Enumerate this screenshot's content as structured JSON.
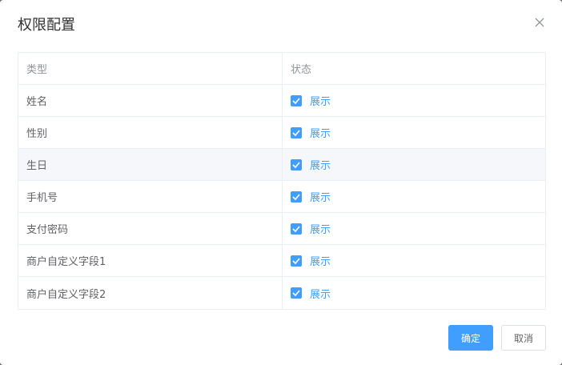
{
  "dialog": {
    "title": "权限配置",
    "close_icon": "close-icon"
  },
  "table": {
    "headers": [
      "类型",
      "状态"
    ],
    "rows": [
      {
        "type": "姓名",
        "checked": true,
        "status_label": "展示"
      },
      {
        "type": "性别",
        "checked": true,
        "status_label": "展示"
      },
      {
        "type": "生日",
        "checked": true,
        "status_label": "展示"
      },
      {
        "type": "手机号",
        "checked": true,
        "status_label": "展示"
      },
      {
        "type": "支付密码",
        "checked": true,
        "status_label": "展示"
      },
      {
        "type": "商户自定义字段1",
        "checked": true,
        "status_label": "展示"
      },
      {
        "type": "商户自定义字段2",
        "checked": true,
        "status_label": "展示"
      }
    ]
  },
  "footer": {
    "confirm_label": "确定",
    "cancel_label": "取消"
  },
  "colors": {
    "primary": "#409eff",
    "text": "#606266",
    "header_text": "#909399",
    "border": "#ebeef5",
    "hover_row": "#f5f7fa"
  }
}
